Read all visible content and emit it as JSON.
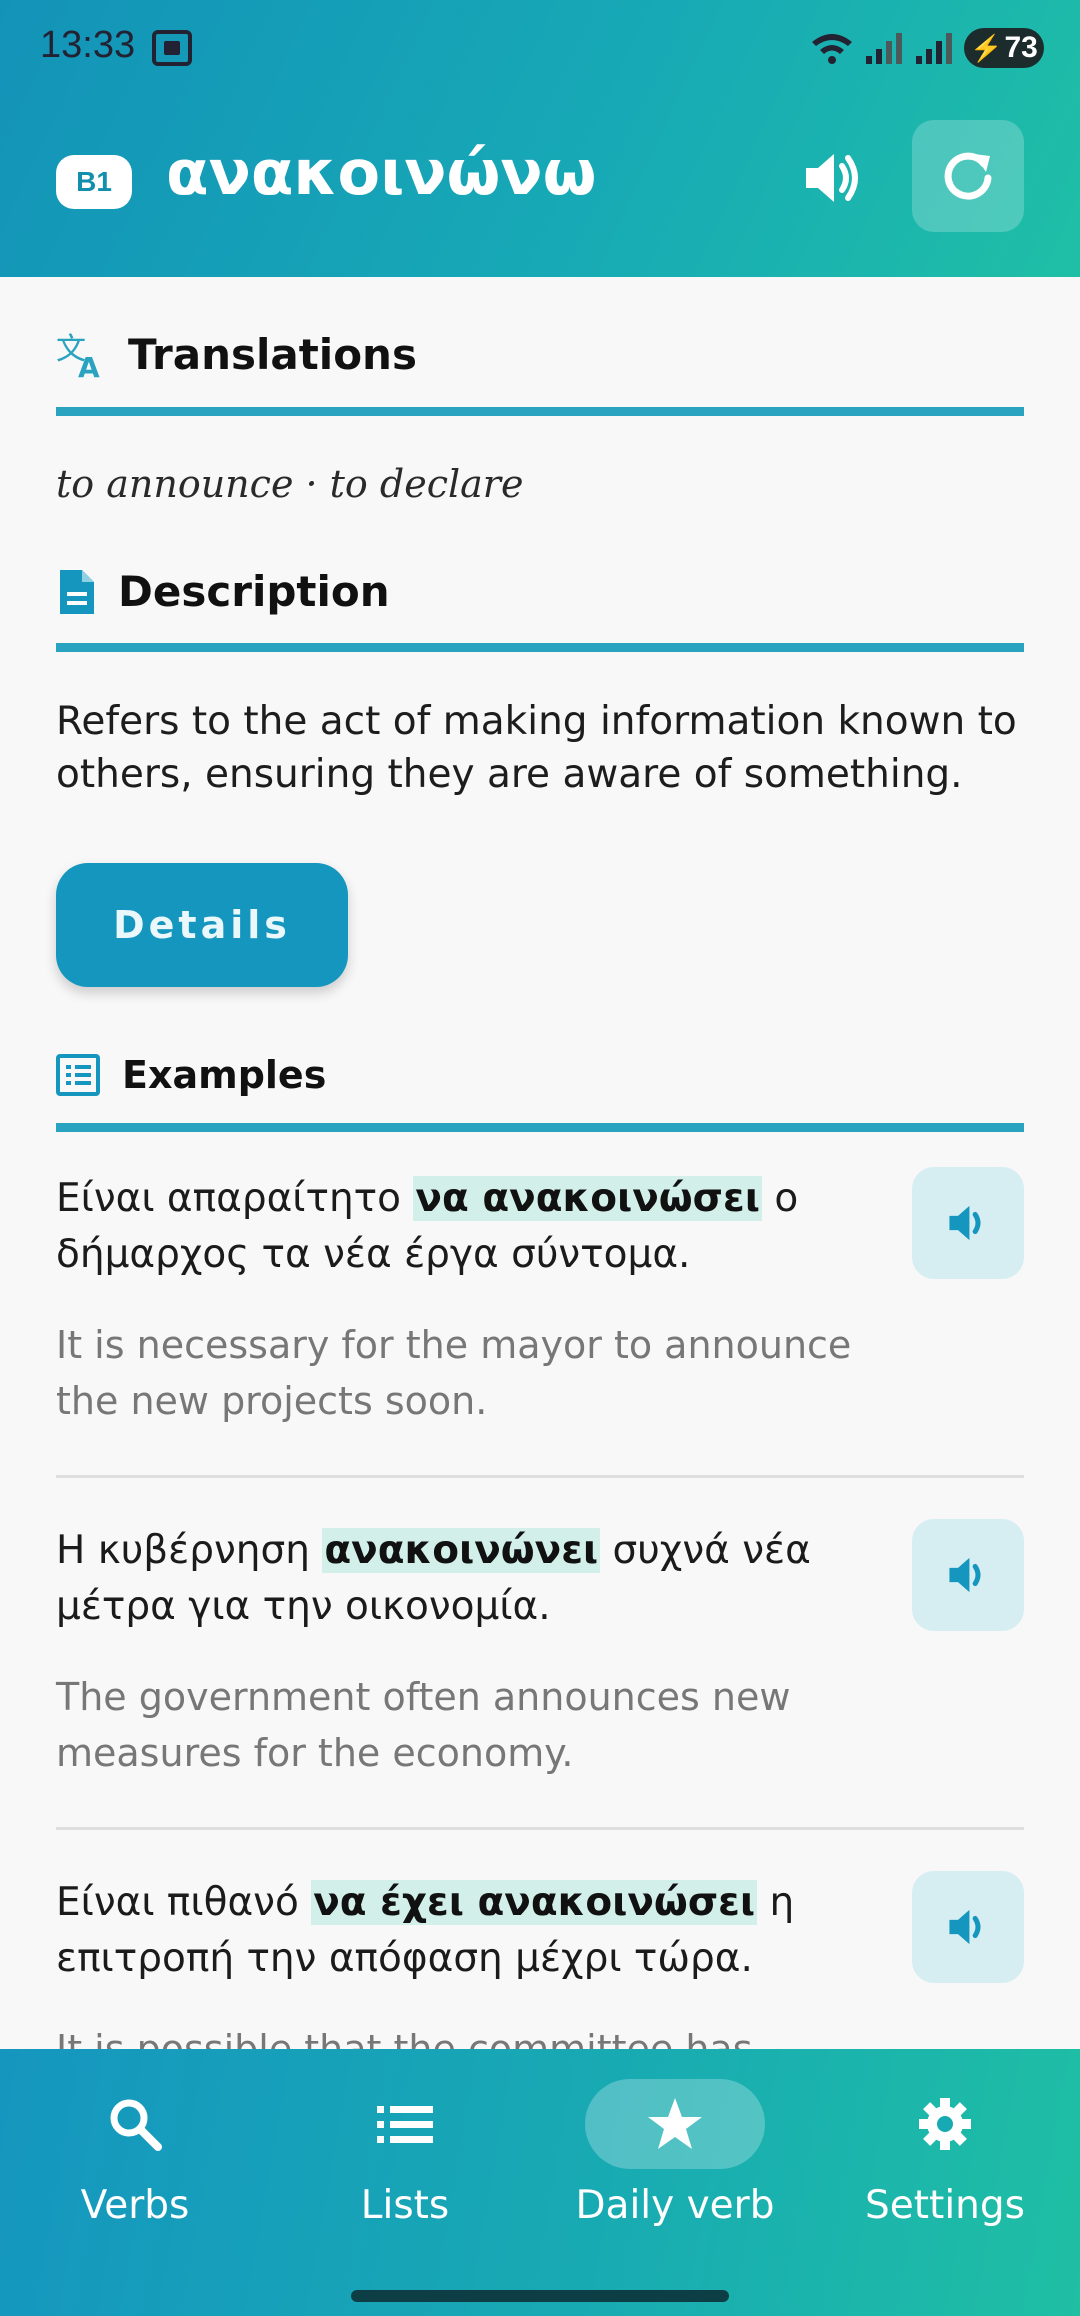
{
  "status_bar": {
    "time": "13:33",
    "battery": "73"
  },
  "header": {
    "level": "B1",
    "verb": "ανακοινώνω"
  },
  "sections": {
    "translations_title": "Translations",
    "translations_text": "to announce · to declare",
    "description_title": "Description",
    "description_text": "Refers to the act of making information known to others, ensuring they are aware of something.",
    "details_button": "Details",
    "examples_title": "Examples"
  },
  "examples": [
    {
      "greek_before": "Είναι απαραίτητο ",
      "greek_highlight": "να ανακοινώσει",
      "greek_after": " ο δήμαρχος τα νέα έργα σύντομα.",
      "english": "It is necessary for the mayor to announce the new projects soon."
    },
    {
      "greek_before": "Η κυβέρνηση ",
      "greek_highlight": "ανακοινώνει",
      "greek_after": " συχνά νέα μέτρα για την οικονομία.",
      "english": "The government often announces new measures for the economy."
    },
    {
      "greek_before": "Είναι πιθανό ",
      "greek_highlight": "να έχει ανακοινώσει",
      "greek_after": " η επιτροπή την απόφαση μέχρι τώρα.",
      "english": "It is possible that the committee has"
    }
  ],
  "nav": {
    "items": [
      {
        "label": "Verbs",
        "icon": "search-icon"
      },
      {
        "label": "Lists",
        "icon": "list-icon"
      },
      {
        "label": "Daily verb",
        "icon": "star-icon",
        "active": true
      },
      {
        "label": "Settings",
        "icon": "gear-icon"
      }
    ]
  },
  "colors": {
    "accent": "#1596bf",
    "rule": "#2aa3c1",
    "highlight": "#d2efe9"
  }
}
